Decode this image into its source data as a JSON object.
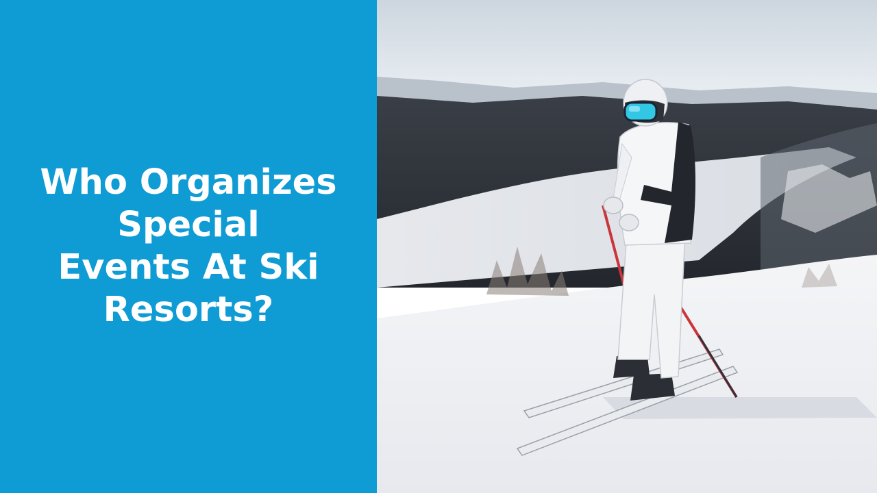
{
  "slide": {
    "title_lines": [
      "Who Organizes",
      "Special",
      "Events At Ski",
      "Resorts?"
    ],
    "accent_color": "#0f9bd3"
  },
  "photo": {
    "subject": "skier standing on snowy slope above valley"
  }
}
